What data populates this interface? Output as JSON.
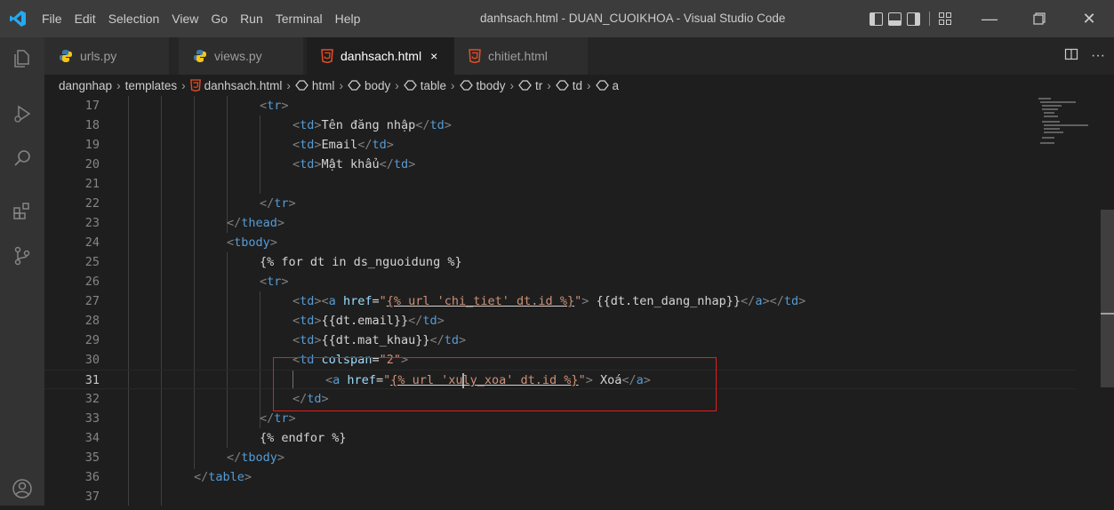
{
  "titlebar": {
    "menu": [
      "File",
      "Edit",
      "Selection",
      "View",
      "Go",
      "Run",
      "Terminal",
      "Help"
    ],
    "window_title": "danhsach.html - DUAN_CUOIKHOA - Visual Studio Code"
  },
  "tabs": [
    {
      "label": "urls.py",
      "icon": "python-icon",
      "active": false
    },
    {
      "label": "views.py",
      "icon": "python-icon",
      "active": false
    },
    {
      "label": "danhsach.html",
      "icon": "html5-icon",
      "active": true,
      "close": "×"
    },
    {
      "label": "chitiet.html",
      "icon": "html5-icon",
      "active": false
    }
  ],
  "breadcrumb": [
    "dangnhap",
    "templates",
    "danhsach.html",
    "html",
    "body",
    "table",
    "tbody",
    "tr",
    "td",
    "a"
  ],
  "editor": {
    "current_line": 31,
    "lines": [
      {
        "n": "17"
      },
      {
        "n": "18"
      },
      {
        "n": "19"
      },
      {
        "n": "20"
      },
      {
        "n": "21"
      },
      {
        "n": "22"
      },
      {
        "n": "23"
      },
      {
        "n": "24"
      },
      {
        "n": "25"
      },
      {
        "n": "26"
      },
      {
        "n": "27"
      },
      {
        "n": "28"
      },
      {
        "n": "29"
      },
      {
        "n": "30"
      },
      {
        "n": "31"
      },
      {
        "n": "32"
      },
      {
        "n": "33"
      },
      {
        "n": "34"
      },
      {
        "n": "35"
      },
      {
        "n": "36"
      },
      {
        "n": "37"
      }
    ],
    "text": {
      "l18": "Tên đăng nhập",
      "l19": "Email",
      "l20": "Mật khẩu",
      "l25": "{% for dt in ds_nguoidung %}",
      "l27_href": "{% url 'chi_tiet' dt.id %}",
      "l27_body": " {{dt.ten_dang_nhap}}",
      "l28": "{{dt.email}}",
      "l29": "{{dt.mat_khau}}",
      "l30_val": "\"2\"",
      "l31_href_a": "{% url 'xu",
      "l31_href_b": "ly_xoa' dt.id %",
      "l31_href_c": "}",
      "l31_body": " Xoá",
      "l34": "{% endfor %}"
    }
  },
  "colors": {
    "highlight_box": "#e01f1f",
    "tag": "#569cd6",
    "attr": "#9cdcfe",
    "string": "#ce9178"
  }
}
